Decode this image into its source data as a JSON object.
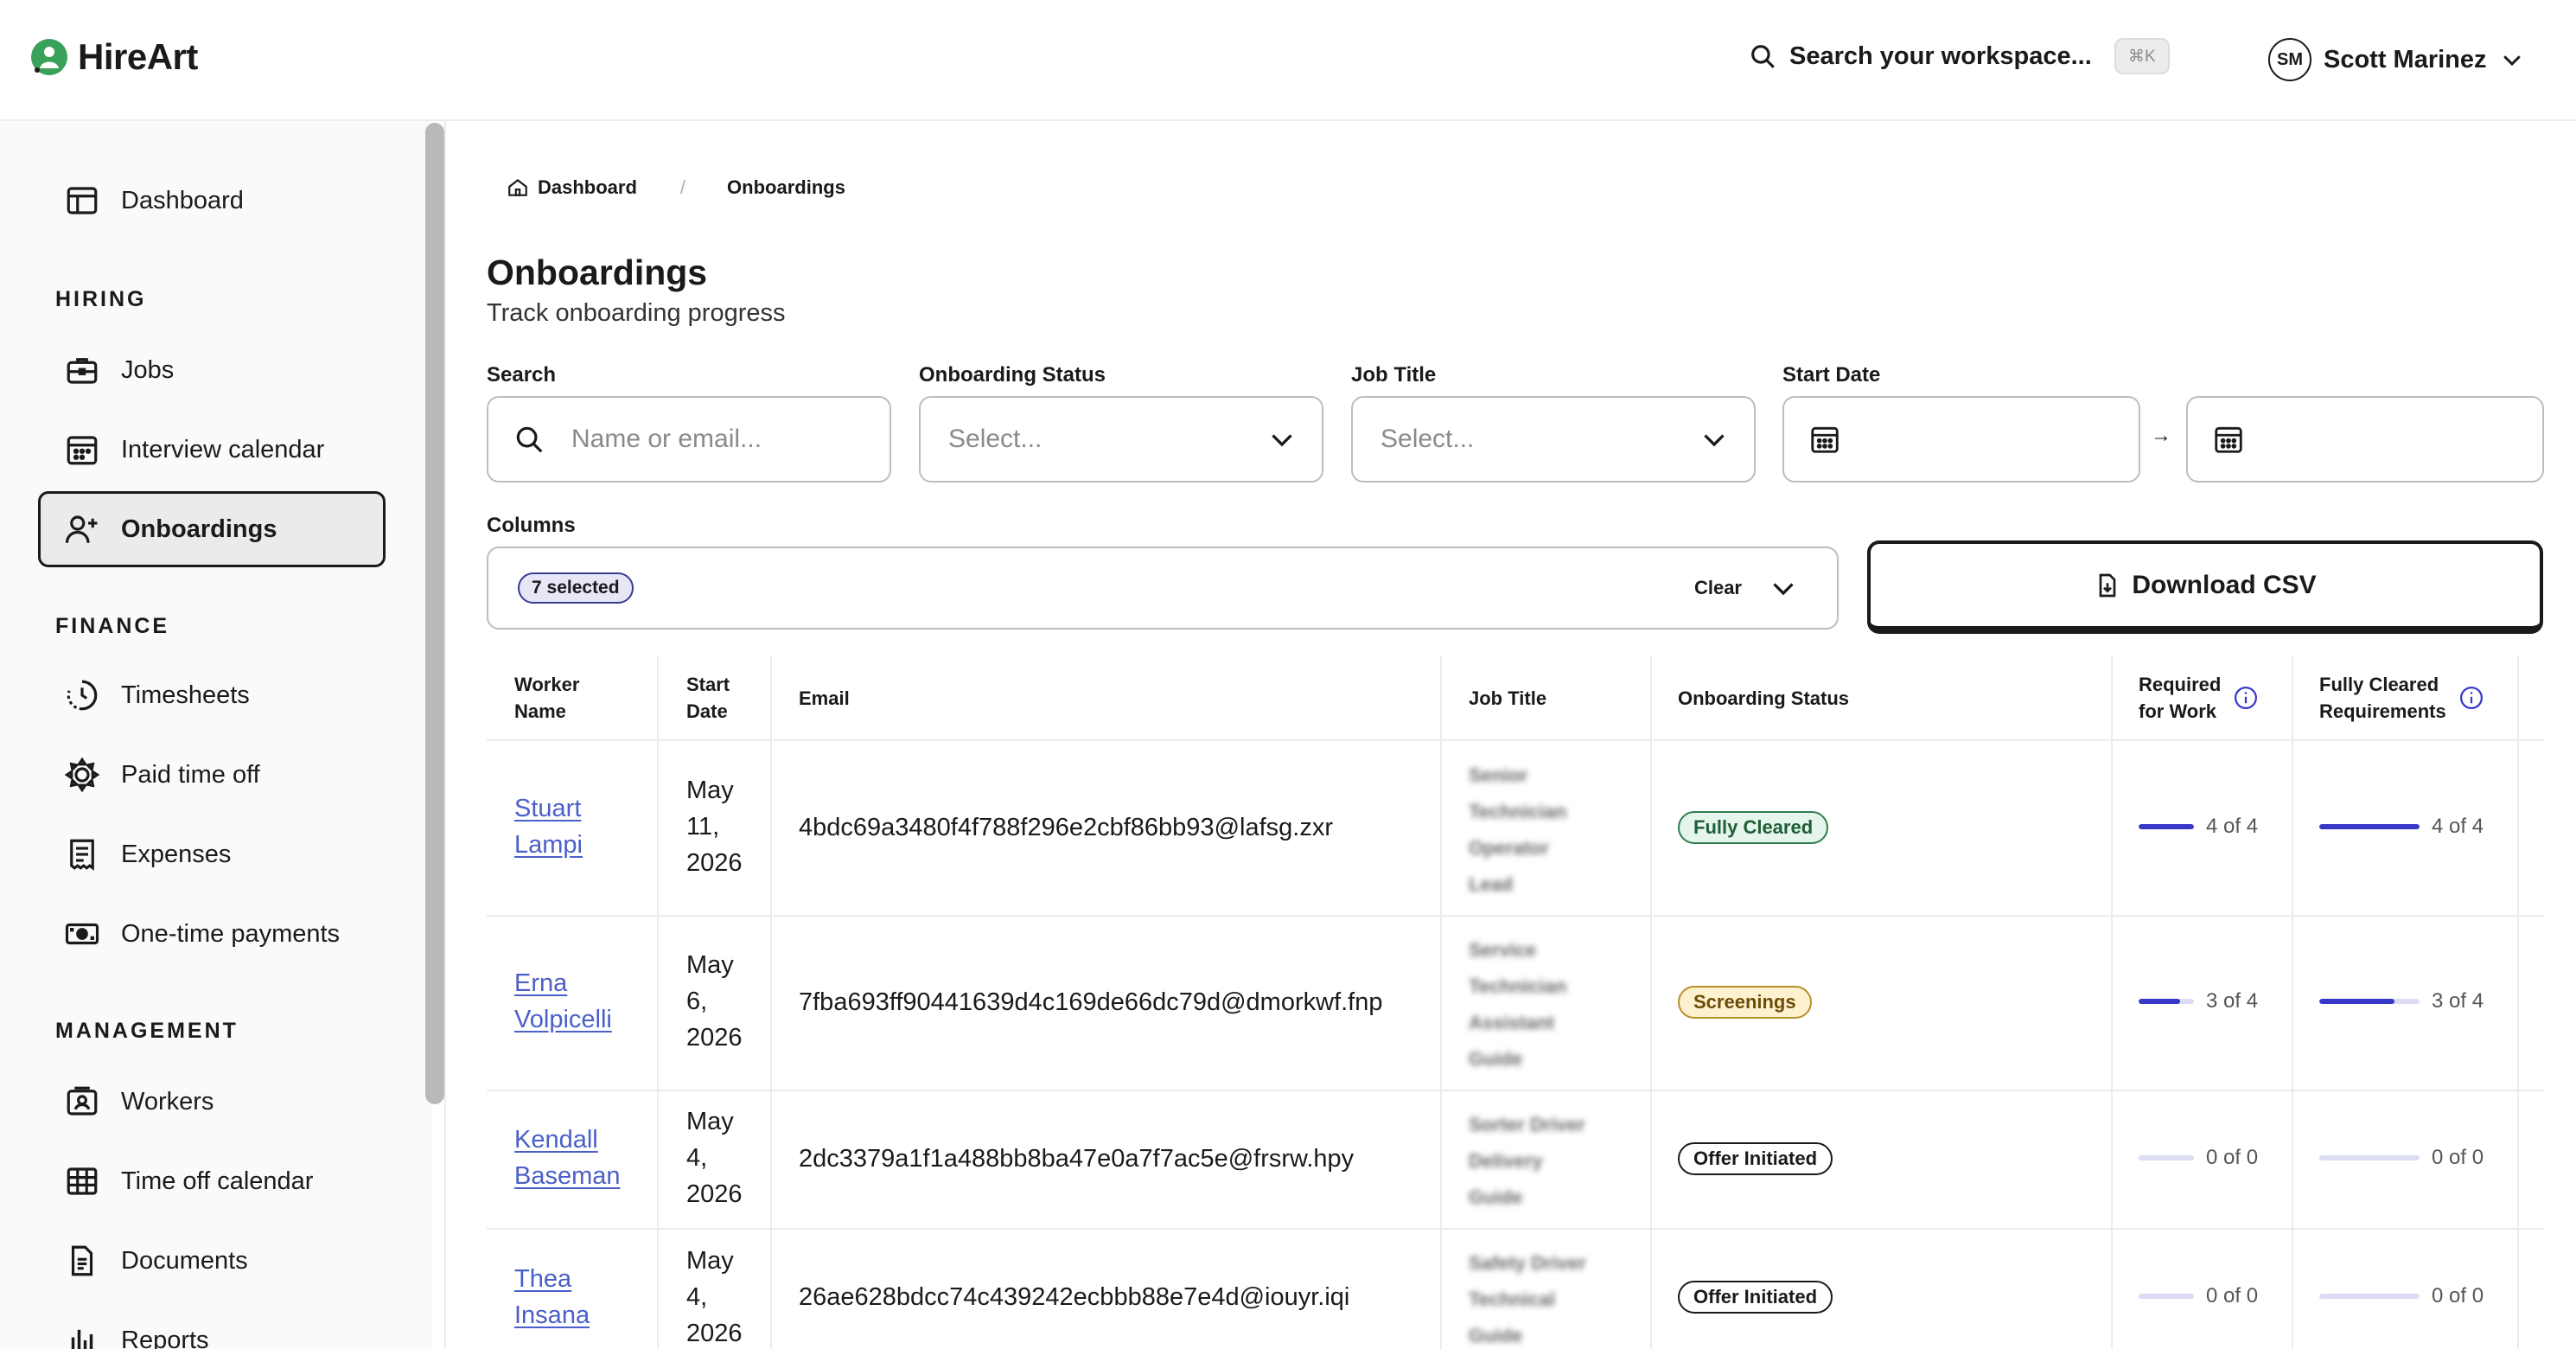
{
  "app": {
    "name": "HireArt"
  },
  "header": {
    "search_placeholder": "Search your workspace...",
    "shortcut": "⌘K",
    "user_initials": "SM",
    "user_name": "Scott Marinez"
  },
  "sidebar": {
    "dashboard": "Dashboard",
    "sections": {
      "hiring": "HIRING",
      "finance": "FINANCE",
      "management": "MANAGEMENT"
    },
    "items": {
      "jobs": "Jobs",
      "interview_calendar": "Interview calendar",
      "onboardings": "Onboardings",
      "timesheets": "Timesheets",
      "paid_time_off": "Paid time off",
      "expenses": "Expenses",
      "one_time_payments": "One-time payments",
      "workers": "Workers",
      "time_off_calendar": "Time off calendar",
      "documents": "Documents",
      "reports": "Reports"
    }
  },
  "breadcrumb": {
    "home": "Dashboard",
    "separator": "/",
    "current": "Onboardings"
  },
  "page": {
    "title": "Onboardings",
    "subtitle": "Track onboarding progress"
  },
  "filters": {
    "search_label": "Search",
    "search_placeholder": "Name or email...",
    "status_label": "Onboarding Status",
    "status_placeholder": "Select...",
    "job_label": "Job Title",
    "job_placeholder": "Select...",
    "start_date_label": "Start Date",
    "date_arrow": "→",
    "columns_label": "Columns",
    "columns_chip": "7 selected",
    "clear": "Clear",
    "download": "Download CSV"
  },
  "table": {
    "headers": {
      "worker_1": "Worker",
      "worker_2": "Name",
      "start_1": "Start",
      "start_2": "Date",
      "email": "Email",
      "job": "Job Title",
      "status": "Onboarding Status",
      "req_1": "Required",
      "req_2": "for Work",
      "full_1": "Fully Cleared",
      "full_2": "Requirements"
    },
    "rows": [
      {
        "first": "Stuart",
        "last": "Lampi",
        "d1": "May",
        "d2": "11,",
        "d3": "2026",
        "email": "4bdc69a3480f4f788f296e2cbf86bb93@lafsg.zxr",
        "job": [
          "Senior",
          "Technician",
          "Operator",
          "Lead"
        ],
        "status": "Fully Cleared",
        "status_kind": "cleared",
        "req": "4 of 4",
        "req_frac": 1.0,
        "full": "4 of 4",
        "full_frac": 1.0
      },
      {
        "first": "Erna",
        "last": "Volpicelli",
        "d1": "May",
        "d2": "6,",
        "d3": "2026",
        "email": "7fba693ff90441639d4c169de66dc79d@dmorkwf.fnp",
        "job": [
          "Service",
          "Technician",
          "Assistant",
          "Guide"
        ],
        "status": "Screenings",
        "status_kind": "screen",
        "req": "3 of 4",
        "req_frac": 0.75,
        "full": "3 of 4",
        "full_frac": 0.75
      },
      {
        "first": "Kendall",
        "last": "Baseman",
        "d1": "May",
        "d2": "4,",
        "d3": "2026",
        "email": "2dc3379a1f1a488bb8ba47e0a7f7ac5e@frsrw.hpy",
        "job": [
          "Sorter Driver",
          "Delivery",
          "Guide"
        ],
        "status": "Offer Initiated",
        "status_kind": "offer",
        "req": "0 of 0",
        "req_frac": 0,
        "full": "0 of 0",
        "full_frac": 0
      },
      {
        "first": "Thea",
        "last": "Insana",
        "d1": "May",
        "d2": "4,",
        "d3": "2026",
        "email": "26ae628bdcc74c439242ecbbb88e7e4d@iouyr.iqi",
        "job": [
          "Safety Driver",
          "Technical",
          "Guide"
        ],
        "status": "Offer Initiated",
        "status_kind": "offer",
        "req": "0 of 0",
        "req_frac": 0,
        "full": "0 of 0",
        "full_frac": 0
      }
    ]
  },
  "colors": {
    "accent": "#3838c8",
    "link": "#4a5fc8",
    "logo_green": "#3aa15a"
  }
}
